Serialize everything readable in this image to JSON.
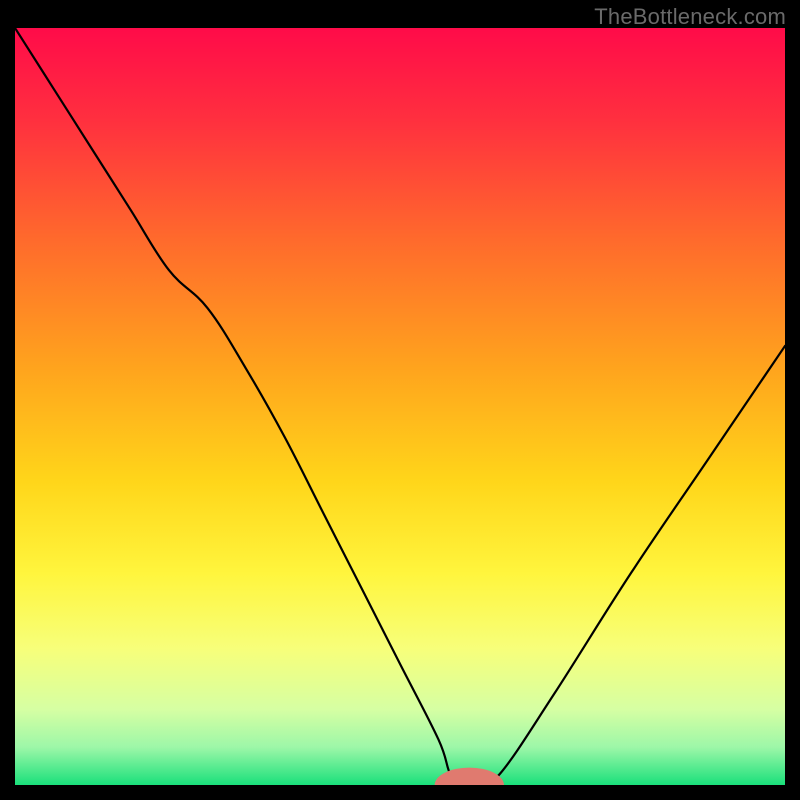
{
  "watermark": "TheBottleneck.com",
  "chart_data": {
    "type": "line",
    "title": "",
    "xlabel": "",
    "ylabel": "",
    "xlim": [
      0,
      100
    ],
    "ylim": [
      0,
      100
    ],
    "x": [
      0,
      5,
      10,
      15,
      20,
      25,
      30,
      35,
      40,
      45,
      50,
      55,
      56.5,
      58,
      60,
      63,
      70,
      80,
      90,
      100
    ],
    "values": [
      100,
      92,
      84,
      76,
      68,
      63,
      55,
      46,
      36,
      26,
      16,
      6,
      1.5,
      0,
      0,
      1.5,
      12,
      28,
      43,
      58
    ],
    "marker": {
      "x": 59,
      "y": 0,
      "color": "#e07a6f",
      "rx": 4.5,
      "ry": 2.3
    },
    "flat_band": {
      "from_x": 55,
      "to_x": 63
    },
    "gradient_stops": [
      {
        "offset": 0.0,
        "color": "#ff0b49"
      },
      {
        "offset": 0.12,
        "color": "#ff2f3f"
      },
      {
        "offset": 0.28,
        "color": "#ff6a2c"
      },
      {
        "offset": 0.45,
        "color": "#ffa41d"
      },
      {
        "offset": 0.6,
        "color": "#ffd61a"
      },
      {
        "offset": 0.72,
        "color": "#fff53d"
      },
      {
        "offset": 0.82,
        "color": "#f7ff7a"
      },
      {
        "offset": 0.9,
        "color": "#d6ffa3"
      },
      {
        "offset": 0.95,
        "color": "#9df7a8"
      },
      {
        "offset": 1.0,
        "color": "#1ae07b"
      }
    ]
  }
}
